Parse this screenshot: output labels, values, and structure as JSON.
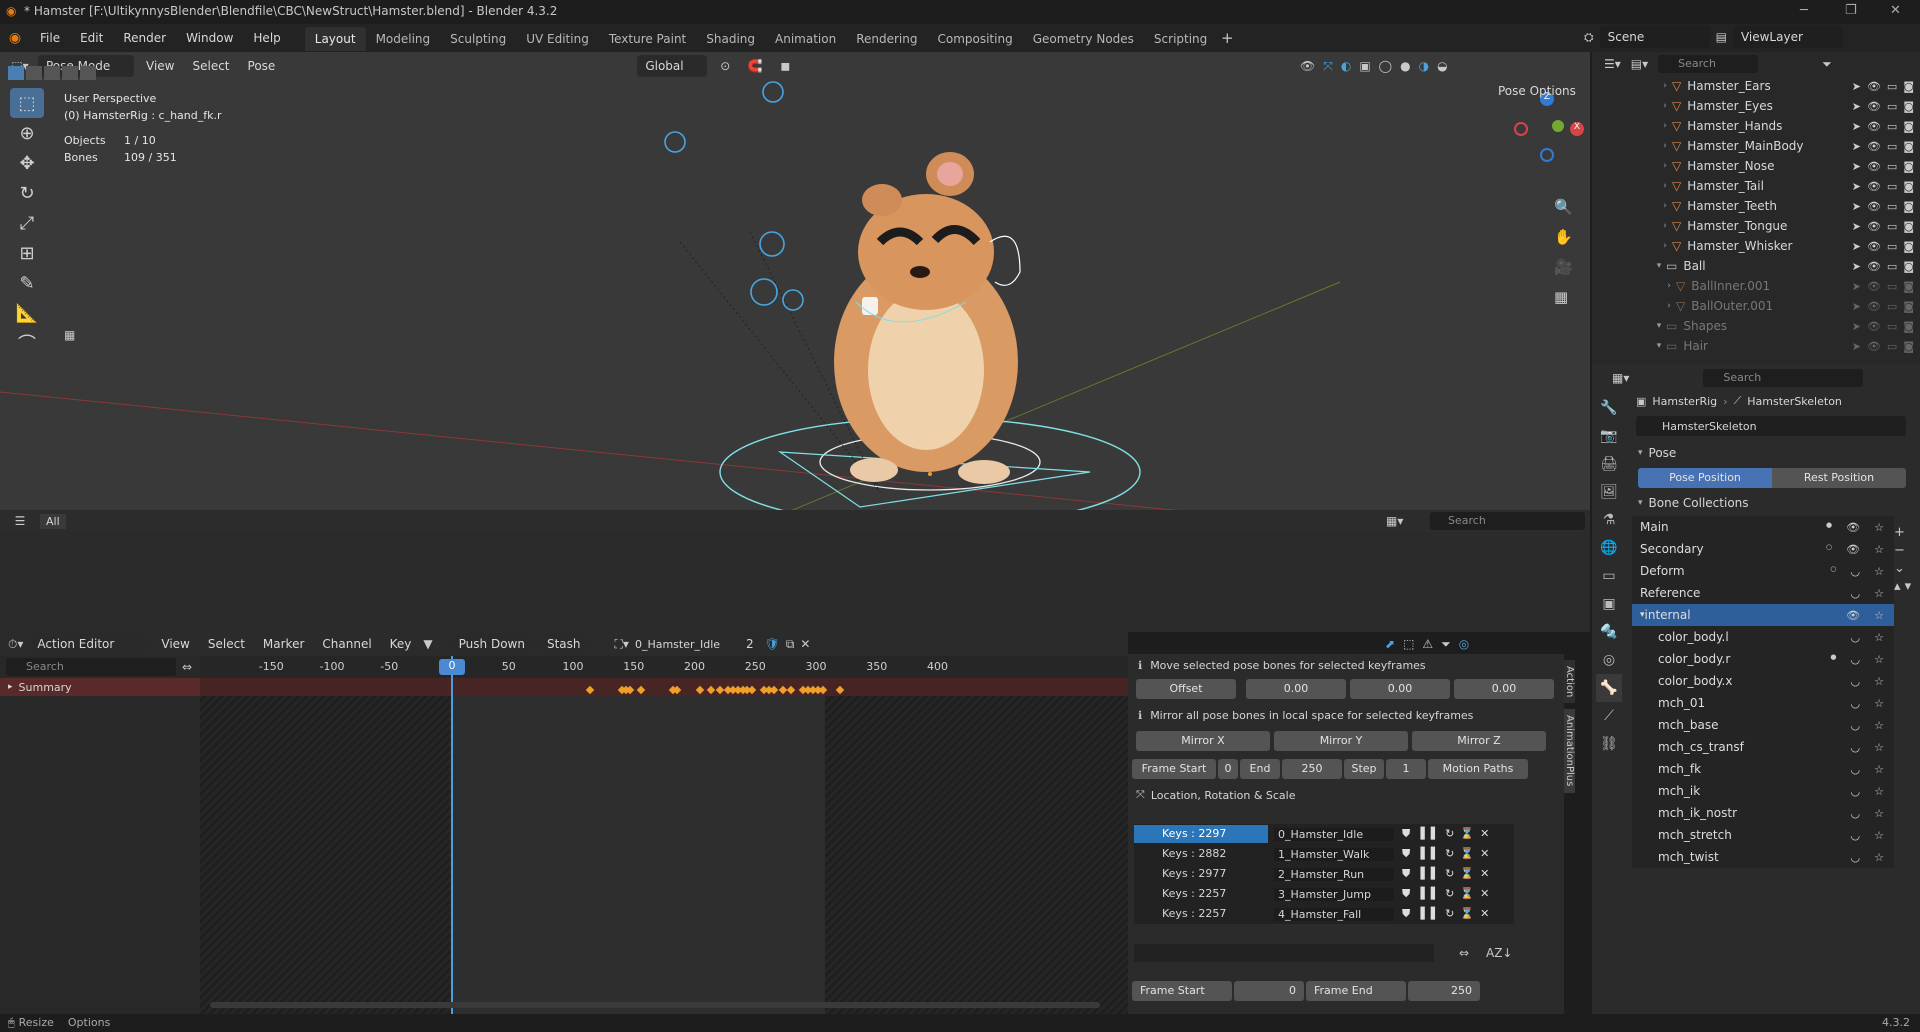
{
  "window": {
    "title": "* Hamster [F:\\UltikynnysBlender\\Blendfile\\CBC\\NewStruct\\Hamster.blend] - Blender 4.3.2"
  },
  "menus": [
    "File",
    "Edit",
    "Render",
    "Window",
    "Help"
  ],
  "workspaces": [
    "Layout",
    "Modeling",
    "Sculpting",
    "UV Editing",
    "Texture Paint",
    "Shading",
    "Animation",
    "Rendering",
    "Compositing",
    "Geometry Nodes",
    "Scripting"
  ],
  "active_workspace": "Layout",
  "scene": {
    "name": "Scene",
    "view_layer": "ViewLayer"
  },
  "viewport_header": {
    "mode": "Pose Mode",
    "menus": [
      "View",
      "Select",
      "Pose"
    ],
    "orientation": "Global",
    "pose_options": "Pose Options"
  },
  "viewport_overlay": {
    "perspective": "User Perspective",
    "context": "(0) HamsterRig : c_hand_fk.r",
    "objects_label": "Objects",
    "objects_value": "1 / 10",
    "bones_label": "Bones",
    "bones_value": "109 / 351"
  },
  "asset_bar": {
    "tab": "All",
    "search_placeholder": "Search"
  },
  "outliner": {
    "search_placeholder": "Search",
    "items": [
      {
        "name": "Hamster_Ears",
        "type": "mesh"
      },
      {
        "name": "Hamster_Eyes",
        "type": "mesh"
      },
      {
        "name": "Hamster_Hands",
        "type": "mesh"
      },
      {
        "name": "Hamster_MainBody",
        "type": "mesh"
      },
      {
        "name": "Hamster_Nose",
        "type": "mesh"
      },
      {
        "name": "Hamster_Tail",
        "type": "mesh"
      },
      {
        "name": "Hamster_Teeth",
        "type": "mesh"
      },
      {
        "name": "Hamster_Tongue",
        "type": "mesh"
      },
      {
        "name": "Hamster_Whisker",
        "type": "mesh"
      },
      {
        "name": "Ball",
        "type": "collection"
      },
      {
        "name": "BallInner.001",
        "type": "mesh-dim"
      },
      {
        "name": "BallOuter.001",
        "type": "mesh-dim"
      },
      {
        "name": "Shapes",
        "type": "collection-dim"
      },
      {
        "name": "Hair",
        "type": "collection-dim"
      }
    ]
  },
  "properties": {
    "search_placeholder": "Search",
    "breadcrumb_rig": "HamsterRig",
    "breadcrumb_skeleton": "HamsterSkeleton",
    "datablock": "HamsterSkeleton",
    "pose_panel": "Pose",
    "pose_position": "Pose Position",
    "rest_position": "Rest Position",
    "bone_collections_panel": "Bone Collections",
    "collections": [
      {
        "name": "Main",
        "dot": true,
        "indent": 0
      },
      {
        "name": "Secondary",
        "dot": false,
        "indent": 0
      },
      {
        "name": "Deform",
        "dot": false,
        "indent": 0
      },
      {
        "name": "Reference",
        "dot": false,
        "indent": 0
      },
      {
        "name": "internal",
        "dot": false,
        "indent": 0,
        "selected": true
      },
      {
        "name": "color_body.l",
        "dot": false,
        "indent": 1
      },
      {
        "name": "color_body.r",
        "dot": true,
        "indent": 1
      },
      {
        "name": "color_body.x",
        "dot": false,
        "indent": 1
      },
      {
        "name": "mch_01",
        "dot": false,
        "indent": 1
      },
      {
        "name": "mch_base",
        "dot": false,
        "indent": 1
      },
      {
        "name": "mch_cs_transf",
        "dot": false,
        "indent": 1
      },
      {
        "name": "mch_fk",
        "dot": false,
        "indent": 1
      },
      {
        "name": "mch_ik",
        "dot": false,
        "indent": 1
      },
      {
        "name": "mch_ik_nostr",
        "dot": false,
        "indent": 1
      },
      {
        "name": "mch_stretch",
        "dot": false,
        "indent": 1
      },
      {
        "name": "mch_twist",
        "dot": false,
        "indent": 1
      }
    ]
  },
  "dope_sheet": {
    "mode": "Action Editor",
    "menus": [
      "View",
      "Select",
      "Marker",
      "Channel",
      "Key"
    ],
    "push_down": "Push Down",
    "stash": "Stash",
    "action_name": "0_Hamster_Idle",
    "users": "2",
    "search_placeholder": "Search",
    "summary": "Summary",
    "current_frame": "0",
    "ruler": [
      "-150",
      "-100",
      "-50",
      "0",
      "50",
      "100",
      "150",
      "200",
      "250",
      "300",
      "350",
      "400"
    ],
    "keyframes": [
      114,
      141,
      144,
      147,
      156,
      183,
      186,
      205,
      214,
      221,
      228,
      232,
      236,
      240,
      244,
      248,
      258,
      262,
      266,
      273,
      280,
      290,
      294,
      298,
      302,
      306,
      320
    ]
  },
  "anim_panel": {
    "move_msg": "Move selected pose bones for selected keyframes",
    "offset_label": "Offset",
    "offset_values": [
      "0.00",
      "0.00",
      "0.00"
    ],
    "mirror_msg": "Mirror all pose bones in local space for selected keyframes",
    "mirror_x": "Mirror X",
    "mirror_y": "Mirror Y",
    "mirror_z": "Mirror Z",
    "frame_start_label": "Frame Start",
    "frame_start": "0",
    "end_label": "End",
    "end": "250",
    "step_label": "Step",
    "step": "1",
    "motion_paths": "Motion Paths",
    "lrs": "Location, Rotation & Scale",
    "actions": [
      {
        "keys": "Keys : 2297",
        "name": "0_Hamster_Idle",
        "active": true
      },
      {
        "keys": "Keys : 2882",
        "name": "1_Hamster_Walk",
        "active": false
      },
      {
        "keys": "Keys : 2977",
        "name": "2_Hamster_Run",
        "active": false
      },
      {
        "keys": "Keys : 2257",
        "name": "3_Hamster_Jump",
        "active": false
      },
      {
        "keys": "Keys : 2257",
        "name": "4_Hamster_Fall",
        "active": false
      }
    ],
    "bottom_frame_start_label": "Frame Start",
    "bottom_frame_start": "0",
    "bottom_frame_end_label": "Frame End",
    "bottom_frame_end": "250",
    "sidetabs": [
      "Action",
      "AnimationPlus"
    ]
  },
  "statusbar": {
    "resize": "Resize",
    "options": "Options",
    "version": "4.3.2"
  }
}
